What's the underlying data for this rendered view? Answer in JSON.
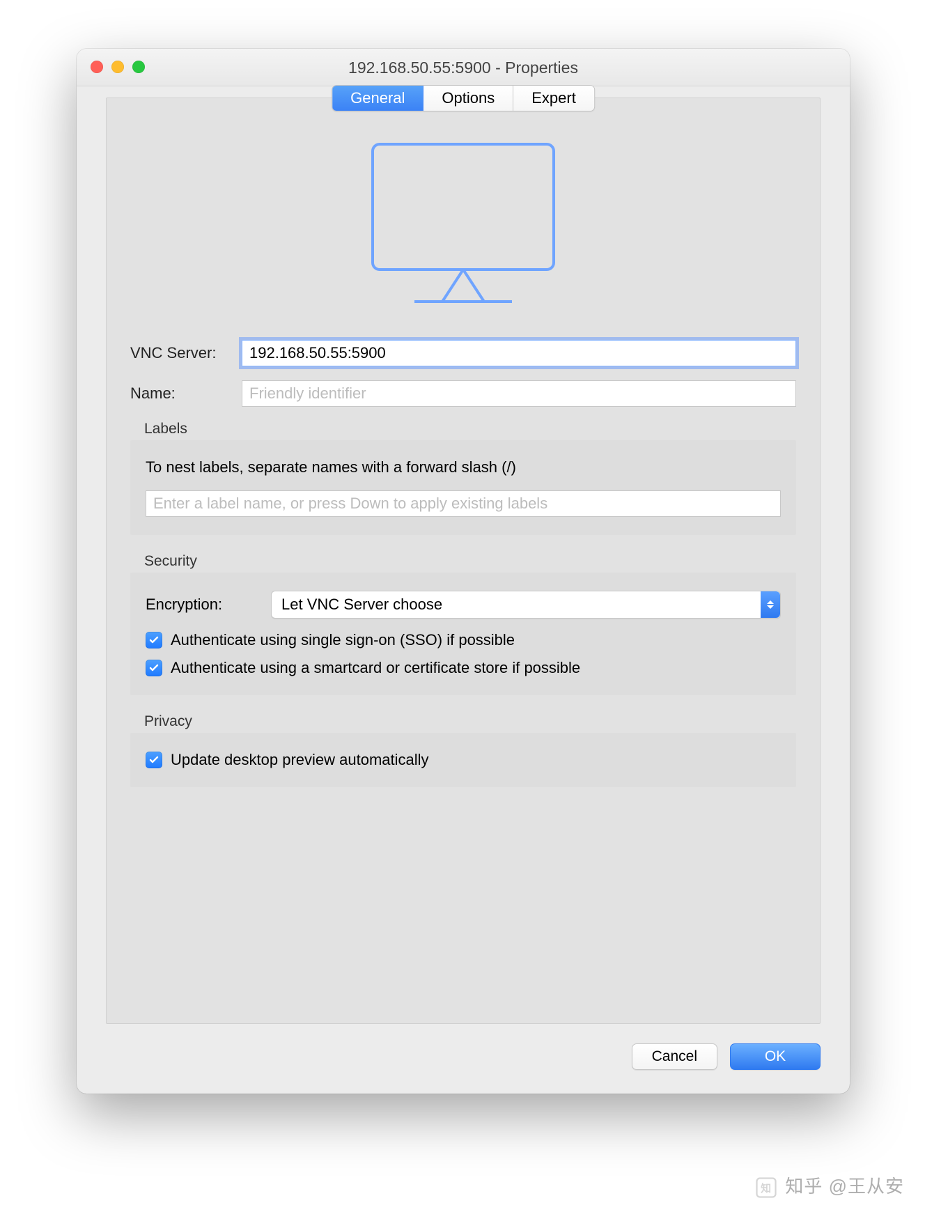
{
  "window": {
    "title": "192.168.50.55:5900 - Properties"
  },
  "tabs": {
    "general": "General",
    "options": "Options",
    "expert": "Expert"
  },
  "form": {
    "vnc_label": "VNC Server:",
    "vnc_value": "192.168.50.55:5900",
    "name_label": "Name:",
    "name_placeholder": "Friendly identifier"
  },
  "labels_section": {
    "heading": "Labels",
    "hint": "To nest labels, separate names with a forward slash (/)",
    "input_placeholder": "Enter a label name, or press Down to apply existing labels"
  },
  "security": {
    "heading": "Security",
    "encryption_label": "Encryption:",
    "encryption_value": "Let VNC Server choose",
    "sso_label": "Authenticate using single sign-on (SSO) if possible",
    "smartcard_label": "Authenticate using a smartcard or certificate store if possible"
  },
  "privacy": {
    "heading": "Privacy",
    "update_label": "Update desktop preview automatically"
  },
  "buttons": {
    "cancel": "Cancel",
    "ok": "OK"
  },
  "watermark": "知乎 @王从安"
}
